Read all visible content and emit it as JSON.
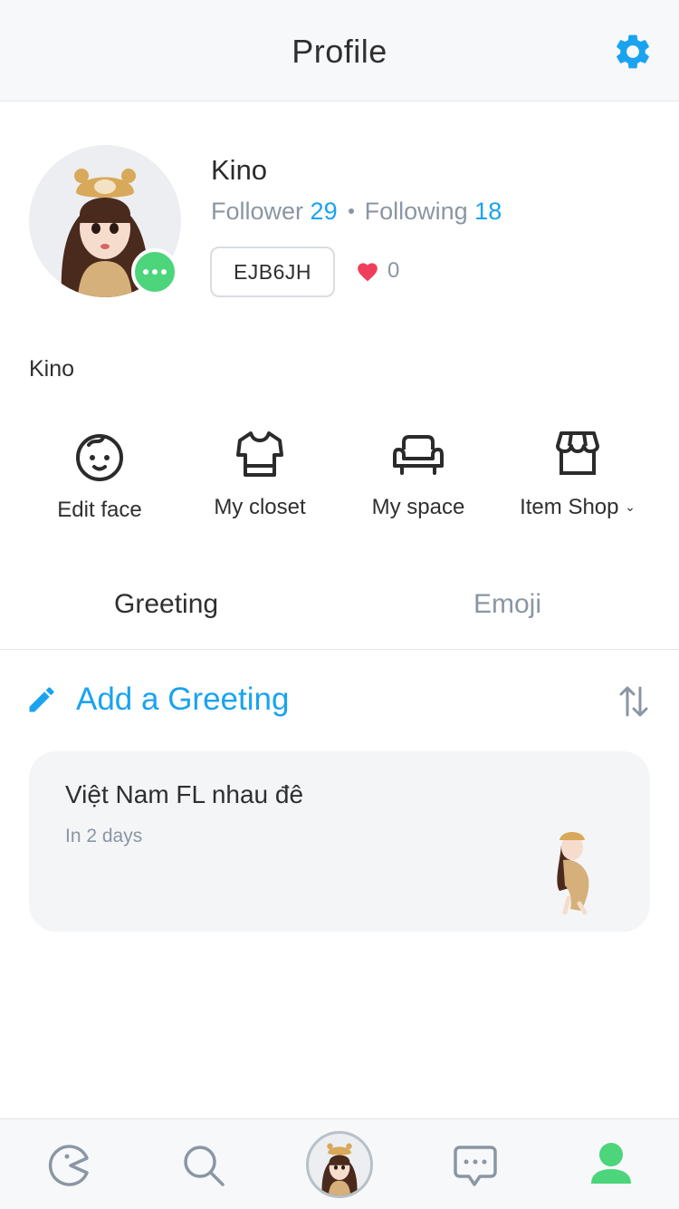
{
  "header": {
    "title": "Profile",
    "settings_icon": "gear-icon"
  },
  "profile": {
    "name": "Kino",
    "follower_label": "Follower",
    "follower_count": "29",
    "following_label": "Following",
    "following_count": "18",
    "code": "EJB6JH",
    "likes": "0",
    "bio": "Kino"
  },
  "menu": [
    {
      "label": "Edit face",
      "icon": "face-icon"
    },
    {
      "label": "My closet",
      "icon": "shirt-icon"
    },
    {
      "label": "My space",
      "icon": "sofa-icon"
    },
    {
      "label": "Item Shop",
      "icon": "shop-icon"
    }
  ],
  "tabs": [
    {
      "label": "Greeting"
    },
    {
      "label": "Emoji"
    }
  ],
  "greeting": {
    "add_label": "Add a Greeting",
    "cards": [
      {
        "text": "Việt Nam FL nhau đê",
        "time": "In 2 days"
      }
    ]
  },
  "bottom_nav": [
    {
      "icon": "pacman-icon"
    },
    {
      "icon": "search-icon"
    },
    {
      "icon": "avatar-icon"
    },
    {
      "icon": "chat-icon"
    },
    {
      "icon": "profile-icon"
    }
  ],
  "colors": {
    "accent": "#1aa3f0",
    "green": "#4cd57a",
    "heart": "#f03e5a",
    "muted": "#8a96a3"
  }
}
